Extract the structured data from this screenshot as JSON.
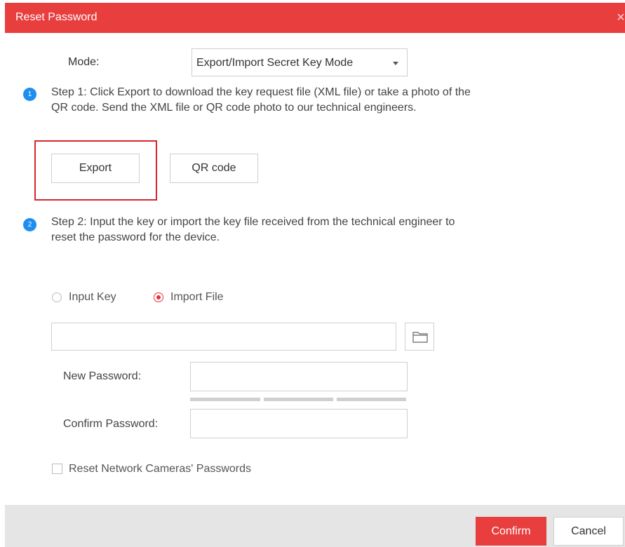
{
  "window": {
    "title": "Reset Password",
    "close_icon": "close-icon",
    "accent_color": "#e83e3e"
  },
  "mode": {
    "label": "Mode:",
    "selected": "Export/Import Secret Key Mode"
  },
  "step1": {
    "badge": "1",
    "text": "Step 1: Click Export to download the key request file (XML file) or take a photo of the QR code. Send the XML file or QR code photo to our technical engineers.",
    "export_label": "Export",
    "qr_label": "QR code"
  },
  "step2": {
    "badge": "2",
    "text": "Step 2: Input the key or import the key file received from the technical engineer to reset the password for the device."
  },
  "import": {
    "input_key_label": "Input Key",
    "import_file_label": "Import File",
    "selected": "Import File",
    "file_path": "",
    "browse_icon": "folder-icon"
  },
  "password": {
    "new_label": "New Password:",
    "confirm_label": "Confirm Password:",
    "new_value": "",
    "confirm_value": ""
  },
  "options": {
    "reset_cameras_label": "Reset Network Cameras' Passwords",
    "reset_cameras_checked": false
  },
  "footer": {
    "confirm_label": "Confirm",
    "cancel_label": "Cancel"
  }
}
